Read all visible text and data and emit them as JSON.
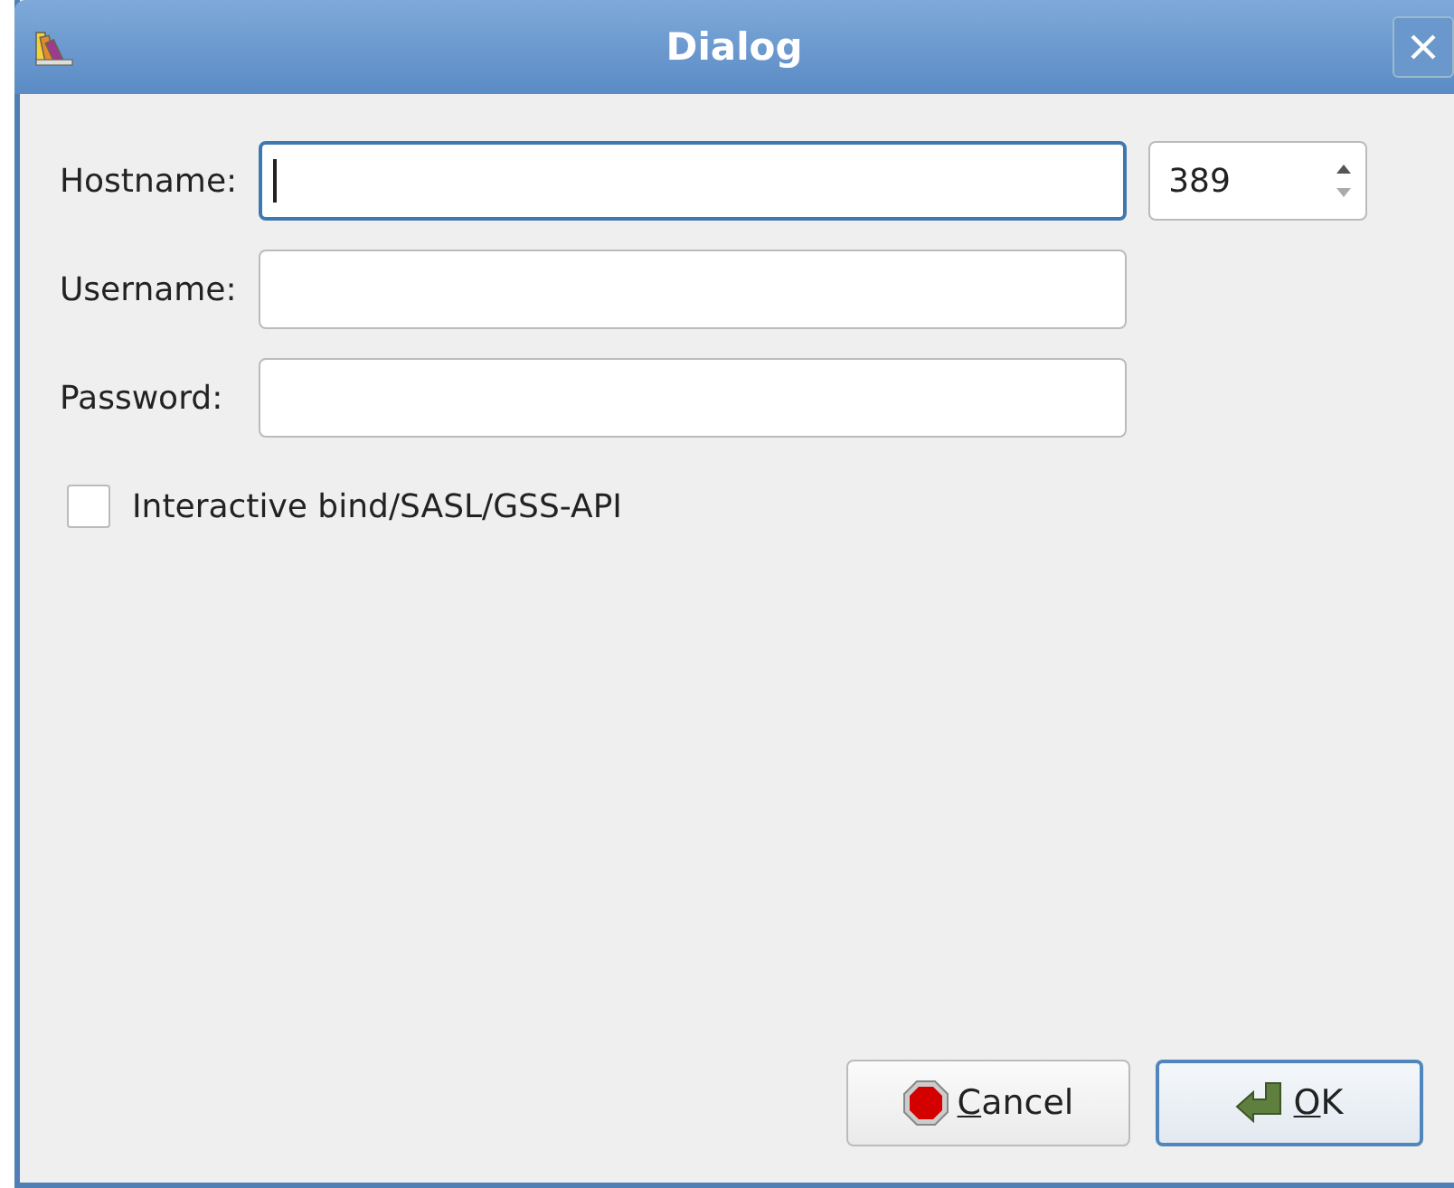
{
  "window": {
    "title": "Dialog"
  },
  "fields": [
    {
      "label": "Hostname:",
      "focused": true
    },
    {
      "label": "Username:",
      "focused": false
    },
    {
      "label": "Password:",
      "focused": false
    }
  ],
  "port": {
    "value": "389"
  },
  "checkbox": {
    "label": "Interactive bind/SASL/GSS-API",
    "checked": false
  },
  "buttons": [
    {
      "kind": "cancel",
      "label": "Cancel",
      "default": false
    },
    {
      "kind": "ok",
      "label": "OK",
      "default": true
    }
  ]
}
